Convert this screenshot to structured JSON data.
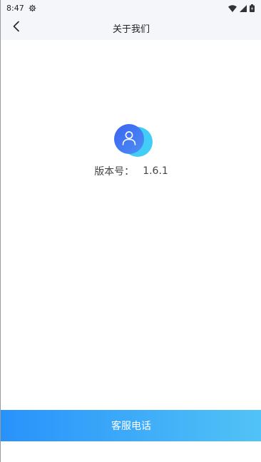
{
  "status_bar": {
    "time": "8:47"
  },
  "nav": {
    "title": "关于我们"
  },
  "about": {
    "version_label": "版本号：",
    "version_value": "1.6.1"
  },
  "footer": {
    "service_label": "客服电话"
  },
  "colors": {
    "accent_start": "#2892fb",
    "accent_end": "#52c3f6",
    "header_bg": "#f5f6fa"
  }
}
